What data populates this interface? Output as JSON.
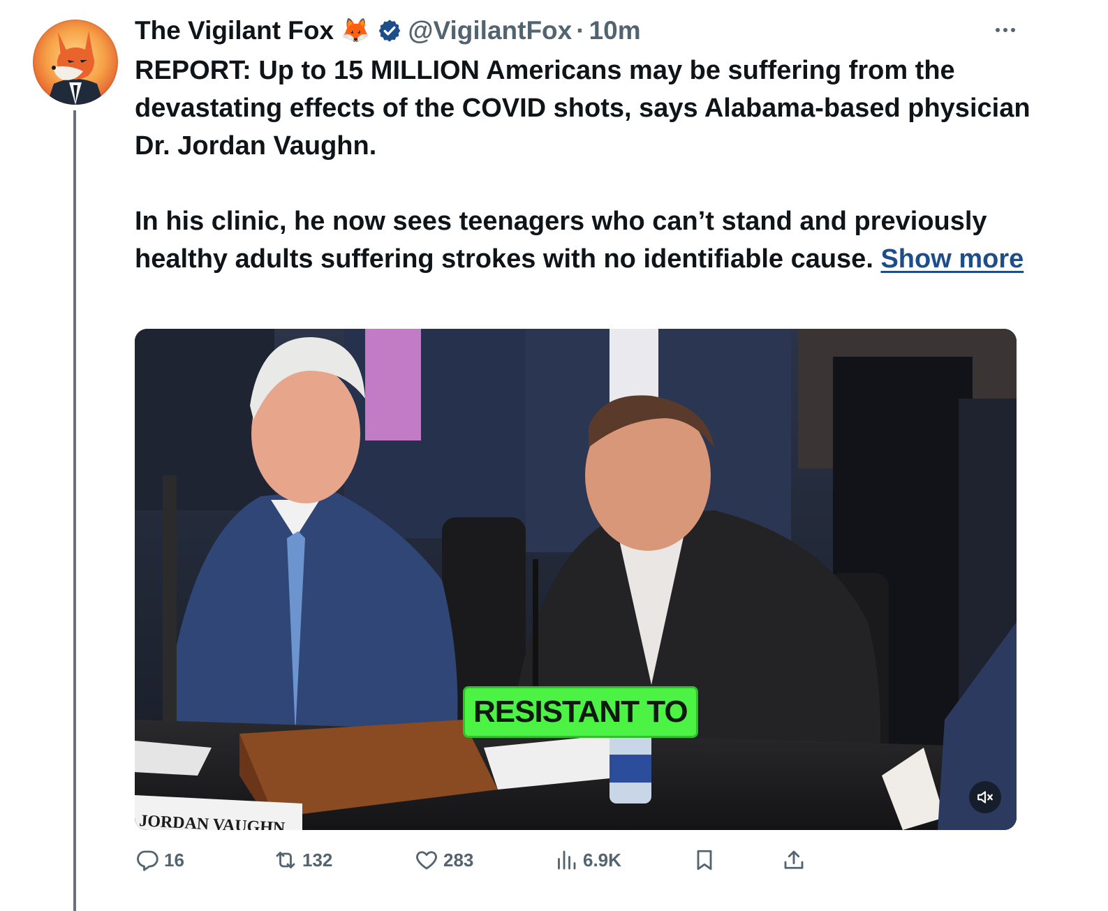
{
  "author": {
    "name": "The Vigilant Fox",
    "emoji": "🦊",
    "handle": "@VigilantFox",
    "separator": "·",
    "time": "10m",
    "verified": true
  },
  "tweet": {
    "paragraph1": "REPORT: Up to 15 MILLION Americans may be suffering from the devastating effects of the COVID shots, says Alabama-based physician Dr. Jordan Vaughn.",
    "paragraph2": "In his clinic, he now sees teenagers who can’t stand and previously healthy adults suffering strokes with no identifiable cause.",
    "show_more": "Show more"
  },
  "media": {
    "type": "video",
    "caption": "RESISTANT TO",
    "nameplate": "JORDAN VAUGHN",
    "muted": true
  },
  "actions": {
    "replies": "16",
    "retweets": "132",
    "likes": "283",
    "views": "6.9K"
  },
  "colors": {
    "text": "#0f1419",
    "secondary": "#536471",
    "link": "#1d4e89",
    "verified": "#1d4e89",
    "caption_bg": "#4cf244"
  },
  "icons": {
    "more": "more-horizontal-icon",
    "reply": "reply-icon",
    "retweet": "retweet-icon",
    "like": "heart-icon",
    "views": "views-icon",
    "bookmark": "bookmark-icon",
    "share": "share-icon",
    "mute": "speaker-muted-icon"
  }
}
